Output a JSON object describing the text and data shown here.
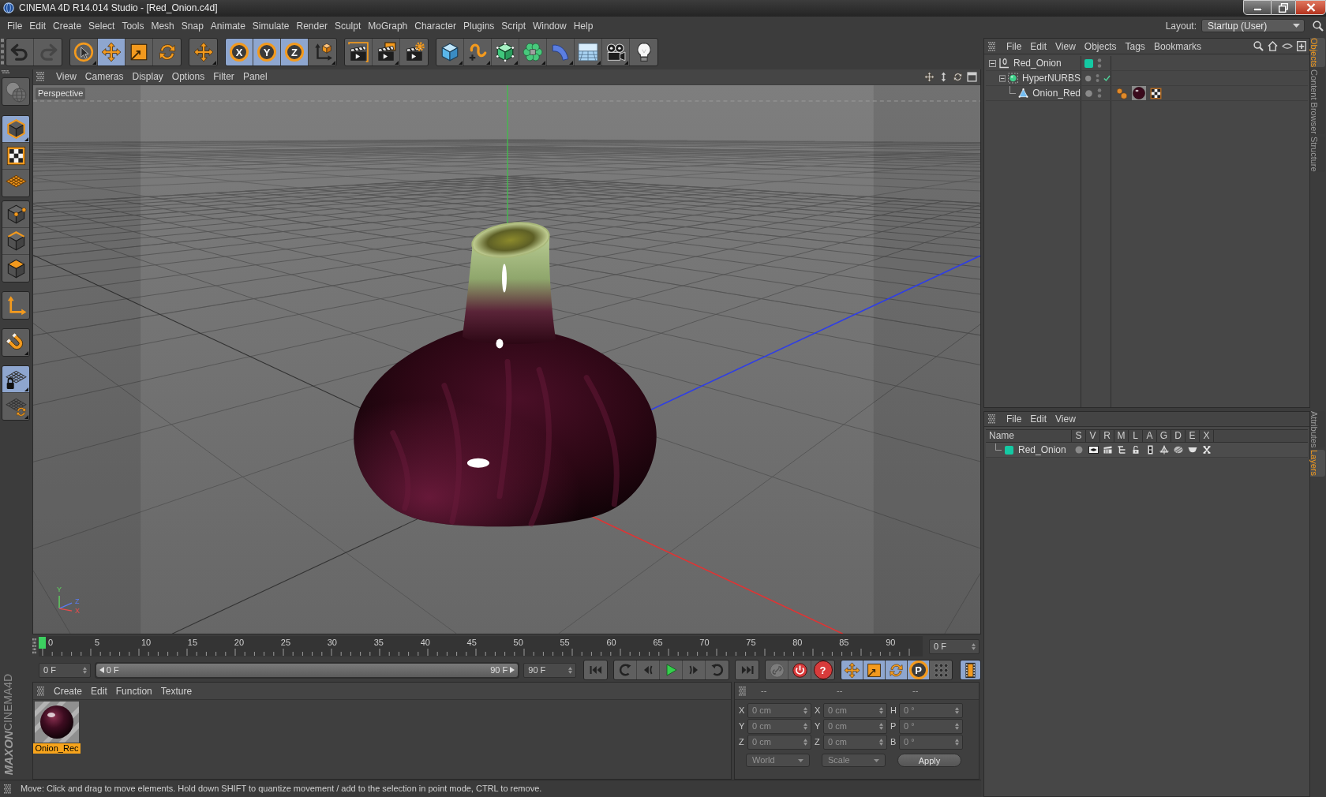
{
  "window": {
    "title": "CINEMA 4D R14.014 Studio - [Red_Onion.c4d]"
  },
  "menu": [
    "File",
    "Edit",
    "Create",
    "Select",
    "Tools",
    "Mesh",
    "Snap",
    "Animate",
    "Simulate",
    "Render",
    "Sculpt",
    "MoGraph",
    "Character",
    "Plugins",
    "Script",
    "Window",
    "Help"
  ],
  "layout": {
    "label": "Layout:",
    "value": "Startup (User)"
  },
  "toolbar": [
    [
      {
        "kind": "undo",
        "selected": false,
        "disabled": false
      },
      {
        "kind": "redo",
        "selected": false,
        "disabled": true
      }
    ],
    [
      {
        "kind": "select",
        "selected": false,
        "flyout": true
      },
      {
        "kind": "move",
        "selected": true
      },
      {
        "kind": "scale",
        "selected": false
      },
      {
        "kind": "rotate",
        "selected": false
      }
    ],
    [
      {
        "kind": "recent",
        "selected": false,
        "flyout": true
      }
    ],
    [
      {
        "kind": "axis",
        "label": "X",
        "selected": true
      },
      {
        "kind": "axis",
        "label": "Y",
        "selected": true
      },
      {
        "kind": "axis",
        "label": "Z",
        "selected": true
      },
      {
        "kind": "coords",
        "selected": false,
        "flyout": true
      }
    ],
    [
      {
        "kind": "render_view",
        "selected": false
      },
      {
        "kind": "render_picture",
        "selected": false,
        "flyout": true
      },
      {
        "kind": "render_settings",
        "selected": false
      }
    ],
    [
      {
        "kind": "cube",
        "selected": false,
        "flyout": true
      },
      {
        "kind": "spline",
        "selected": false,
        "flyout": true
      },
      {
        "kind": "nurbs",
        "selected": false,
        "flyout": true
      },
      {
        "kind": "array",
        "selected": false,
        "flyout": true
      },
      {
        "kind": "deformer",
        "selected": false,
        "flyout": true
      },
      {
        "kind": "floor",
        "selected": false,
        "flyout": true
      },
      {
        "kind": "camera",
        "selected": false,
        "flyout": true
      },
      {
        "kind": "light",
        "selected": false
      }
    ]
  ],
  "left_tools": [
    [
      {
        "kind": "make_editable",
        "selected": false,
        "disabled": true
      }
    ],
    [
      {
        "kind": "model",
        "selected": true,
        "flyout": true
      },
      {
        "kind": "texture",
        "selected": false
      },
      {
        "kind": "workplane",
        "selected": false
      }
    ],
    [
      {
        "kind": "points",
        "selected": false
      },
      {
        "kind": "edges",
        "selected": false
      },
      {
        "kind": "polygons",
        "selected": false
      }
    ],
    [
      {
        "kind": "axis_mode",
        "selected": false
      }
    ],
    [
      {
        "kind": "tweak",
        "selected": false,
        "flyout": true
      }
    ],
    [
      {
        "kind": "workplane_lock",
        "selected": true,
        "flyout": true
      },
      {
        "kind": "workplane_snap",
        "selected": false,
        "flyout": true
      }
    ]
  ],
  "viewport": {
    "menu": [
      "View",
      "Cameras",
      "Display",
      "Options",
      "Filter",
      "Panel"
    ],
    "camera": "Perspective",
    "gizmo": [
      "Y",
      "Z",
      "X"
    ]
  },
  "timeline": {
    "ticks": [
      {
        "label": "0",
        "selected": true
      },
      {
        "label": "5",
        "selected": false
      },
      {
        "label": "10",
        "selected": false
      },
      {
        "label": "15",
        "selected": false
      },
      {
        "label": "20",
        "selected": false
      },
      {
        "label": "25",
        "selected": false
      },
      {
        "label": "30",
        "selected": false
      },
      {
        "label": "35",
        "selected": false
      },
      {
        "label": "40",
        "selected": false
      },
      {
        "label": "45",
        "selected": false
      },
      {
        "label": "50",
        "selected": false
      },
      {
        "label": "55",
        "selected": false
      },
      {
        "label": "60",
        "selected": false
      },
      {
        "label": "65",
        "selected": false
      },
      {
        "label": "70",
        "selected": false
      },
      {
        "label": "75",
        "selected": false
      },
      {
        "label": "80",
        "selected": false
      },
      {
        "label": "85",
        "selected": false
      },
      {
        "label": "90",
        "selected": false
      }
    ],
    "frame": "0 F",
    "start": "0 F",
    "range": {
      "start": "0 F",
      "end": "90 F",
      "level": 1
    },
    "end": "90 F",
    "transport": [
      [
        {
          "kind": "first"
        }
      ],
      [
        {
          "kind": "prev_key"
        },
        {
          "kind": "prev_frame"
        },
        {
          "kind": "play"
        },
        {
          "kind": "next_frame"
        },
        {
          "kind": "next_key"
        }
      ],
      [
        {
          "kind": "last"
        }
      ]
    ],
    "record": [
      {
        "kind": "autokey"
      },
      {
        "kind": "record"
      },
      {
        "kind": "help",
        "label": "?"
      }
    ],
    "keys": [
      {
        "kind": "key_move",
        "selected": true
      },
      {
        "kind": "key_scale",
        "selected": true
      },
      {
        "kind": "key_rotate",
        "selected": true
      },
      {
        "kind": "key_param",
        "label": "P",
        "selected": true
      },
      {
        "kind": "key_points",
        "selected": false
      }
    ],
    "timeline_button": {
      "selected": true
    }
  },
  "materials": {
    "menu": [
      "Create",
      "Edit",
      "Function",
      "Texture"
    ],
    "items": [
      {
        "name": "Onion_Rec",
        "selected": true
      }
    ]
  },
  "coordinates": {
    "disabled": true,
    "headers": [
      "--",
      "--",
      "--"
    ],
    "rows": [
      [
        {
          "label": "X",
          "value": "0 cm"
        },
        {
          "label": "X",
          "value": "0 cm"
        },
        {
          "label": "H",
          "value": "0 °"
        }
      ],
      [
        {
          "label": "Y",
          "value": "0 cm"
        },
        {
          "label": "Y",
          "value": "0 cm"
        },
        {
          "label": "P",
          "value": "0 °"
        }
      ],
      [
        {
          "label": "Z",
          "value": "0 cm"
        },
        {
          "label": "Z",
          "value": "0 cm"
        },
        {
          "label": "B",
          "value": "0 °"
        }
      ]
    ],
    "dropdowns": [
      "World",
      "Scale"
    ],
    "apply": "Apply"
  },
  "logo": {
    "brand": "MAXON",
    "product": "CINEMA4D"
  },
  "status_bar": "Move: Click and drag to move elements. Hold down SHIFT to quantize movement / add to the selection in point mode, CTRL to remove.",
  "objects": {
    "menu": [
      "File",
      "Edit",
      "View",
      "Objects",
      "Tags",
      "Bookmarks"
    ],
    "tree": [
      {
        "name": "Red_Onion",
        "kind": "null",
        "color": "#14c9a3",
        "expanded": true,
        "children": [
          {
            "name": "HyperNURBS",
            "kind": "generator",
            "enabled": true,
            "expanded": true,
            "children": [
              {
                "name": "Onion_Red",
                "kind": "polygon",
                "tags": [
                  {
                    "kind": "phong"
                  },
                  {
                    "kind": "material"
                  },
                  {
                    "kind": "uvw"
                  }
                ]
              }
            ]
          }
        ]
      }
    ]
  },
  "layers": {
    "menu": [
      "File",
      "Edit",
      "View"
    ],
    "columns": [
      "Name",
      "S",
      "V",
      "R",
      "M",
      "L",
      "A",
      "G",
      "D",
      "E",
      "X"
    ],
    "rows": [
      {
        "name": "Red_Onion",
        "color": "#14c9a3",
        "flags": [
          {
            "kind": "solo",
            "on": false
          },
          {
            "kind": "view",
            "on": true
          },
          {
            "kind": "render",
            "on": true
          },
          {
            "kind": "manager",
            "on": true
          },
          {
            "kind": "lock",
            "on": false
          },
          {
            "kind": "animation",
            "on": true
          },
          {
            "kind": "generators",
            "on": true
          },
          {
            "kind": "deformers",
            "on": true
          },
          {
            "kind": "expressions",
            "on": true
          },
          {
            "kind": "xref",
            "on": true
          }
        ]
      }
    ]
  },
  "side_tabs": {
    "top": [
      {
        "label": "Objects",
        "selected": true
      },
      {
        "label": "Content Browser",
        "selected": false
      },
      {
        "label": "Structure",
        "selected": false
      }
    ],
    "bottom": [
      {
        "label": "Attributes",
        "selected": false
      },
      {
        "label": "Layers",
        "selected": true
      }
    ]
  }
}
